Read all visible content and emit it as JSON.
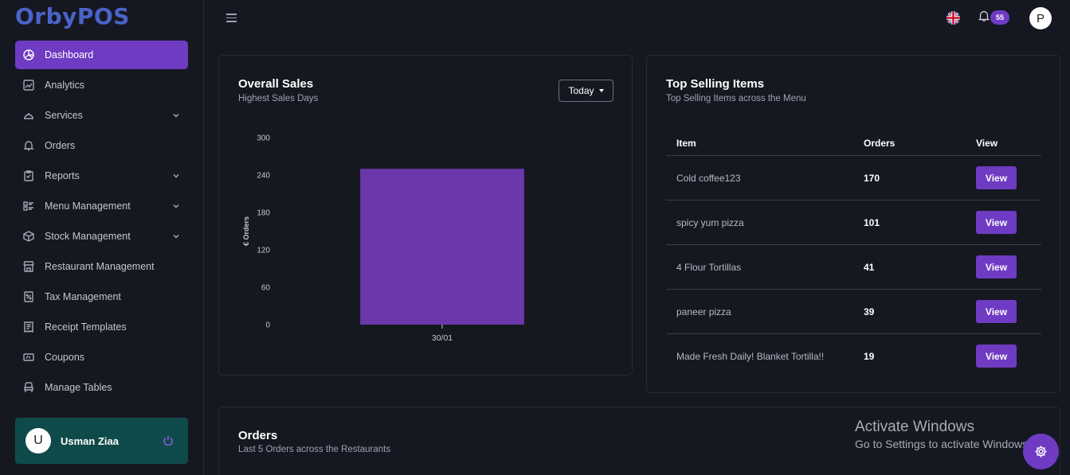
{
  "app": {
    "logo": "OrbyPOS"
  },
  "sidebar": {
    "items": [
      {
        "label": "Dashboard",
        "icon": "dashboard-icon",
        "active": true
      },
      {
        "label": "Analytics",
        "icon": "analytics-icon"
      },
      {
        "label": "Services",
        "icon": "cloche-icon",
        "has_submenu": true
      },
      {
        "label": "Orders",
        "icon": "bell-icon"
      },
      {
        "label": "Reports",
        "icon": "clipboard-icon",
        "has_submenu": true
      },
      {
        "label": "Menu Management",
        "icon": "menu-list-icon",
        "has_submenu": true
      },
      {
        "label": "Stock Management",
        "icon": "box-icon",
        "has_submenu": true
      },
      {
        "label": "Restaurant Management",
        "icon": "store-icon"
      },
      {
        "label": "Tax Management",
        "icon": "tax-icon"
      },
      {
        "label": "Receipt Templates",
        "icon": "receipt-icon"
      },
      {
        "label": "Coupons",
        "icon": "coupon-icon"
      },
      {
        "label": "Manage Tables",
        "icon": "chair-icon"
      }
    ],
    "user": {
      "initial": "U",
      "name": "Usman Ziaa"
    }
  },
  "topbar": {
    "notification_count": "55",
    "profile_initial": "P"
  },
  "overall_sales": {
    "title": "Overall Sales",
    "subtitle": "Highest Sales Days",
    "period": "Today"
  },
  "chart_data": {
    "type": "bar",
    "categories": [
      "30/01"
    ],
    "values": [
      250
    ],
    "title": "",
    "xlabel": "",
    "ylabel": "€ Orders",
    "ylim": [
      0,
      300
    ],
    "yticks": [
      0,
      60,
      120,
      180,
      240,
      300
    ],
    "color": "#6a38aa"
  },
  "top_selling": {
    "title": "Top Selling Items",
    "subtitle": "Top Selling Items across the Menu",
    "columns": [
      "Item",
      "Orders",
      "View"
    ],
    "rows": [
      {
        "item": "Cold coffee123",
        "orders": "170",
        "action": "View"
      },
      {
        "item": "spicy yum pizza",
        "orders": "101",
        "action": "View"
      },
      {
        "item": "4 Flour Tortillas",
        "orders": "41",
        "action": "View"
      },
      {
        "item": "paneer pizza",
        "orders": "39",
        "action": "View"
      },
      {
        "item": "Made Fresh Daily! Blanket Tortilla!!",
        "orders": "19",
        "action": "View"
      }
    ]
  },
  "orders_section": {
    "title": "Orders",
    "subtitle": "Last 5 Orders across the Restaurants"
  },
  "watermark": {
    "line1": "Activate Windows",
    "line2": "Go to Settings to activate Windows."
  },
  "colors": {
    "accent": "#6f3bc3",
    "brand": "#4a63c9",
    "user_card": "#0f4a4a",
    "background": "#151821"
  }
}
